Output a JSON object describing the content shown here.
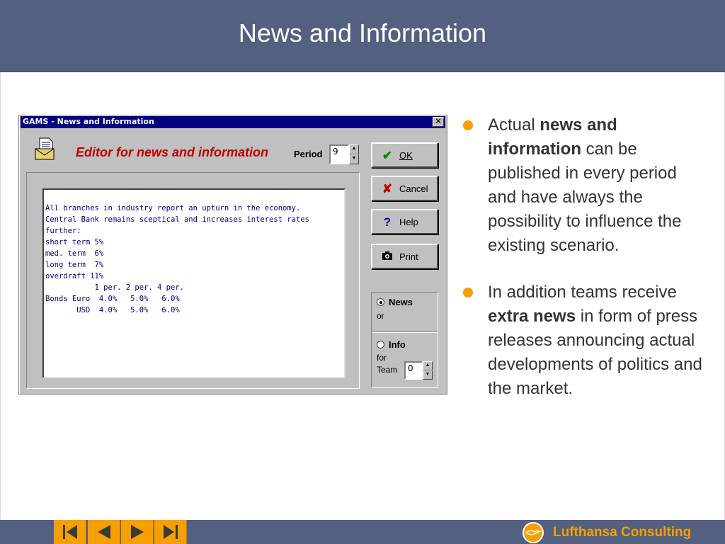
{
  "slide": {
    "title": "News and Information"
  },
  "dialog": {
    "window_title": "GAMS - News and Information",
    "close_glyph": "✕",
    "editor_title": "Editor for news and information",
    "period_label": "Period",
    "period_value": "9",
    "text_lines": [
      "All branches in industry report an upturn in the economy.",
      "Central Bank remains sceptical and increases interest rates",
      "further:",
      "short term 5%",
      "med. term  6%",
      "long term  7%",
      "overdraft 11%",
      "           1 per. 2 per. 4 per.",
      "Bonds Euro  4.0%   5.0%   6.0%",
      "       USD  4.0%   5.0%   6.0%"
    ],
    "buttons": {
      "ok": "OK",
      "cancel": "Cancel",
      "help": "Help",
      "print": "Print"
    },
    "radio": {
      "news_label": "News",
      "or_label": "or",
      "info_label": "Info",
      "for_label": "for",
      "team_label": "Team",
      "team_value": "0",
      "selected": "news"
    }
  },
  "bullets": {
    "b1_pre": "Actual ",
    "b1_bold": "news and information",
    "b1_post": " can be published in every period  and have always the possibility to influence the existing scenario.",
    "b2_pre": "In addition teams receive ",
    "b2_bold": "extra news",
    "b2_post": " in form of press releases announcing actual developments of politics and the market."
  },
  "footer": {
    "brand": "Lufthansa Consulting",
    "nav_icons": [
      "skip-to-first-icon",
      "previous-icon",
      "next-icon",
      "skip-to-last-icon"
    ]
  },
  "colors": {
    "header_bg": "#536080",
    "accent_orange": "#f5a000",
    "dialog_title_bar": "#000080",
    "editor_title_red": "#c00000"
  }
}
